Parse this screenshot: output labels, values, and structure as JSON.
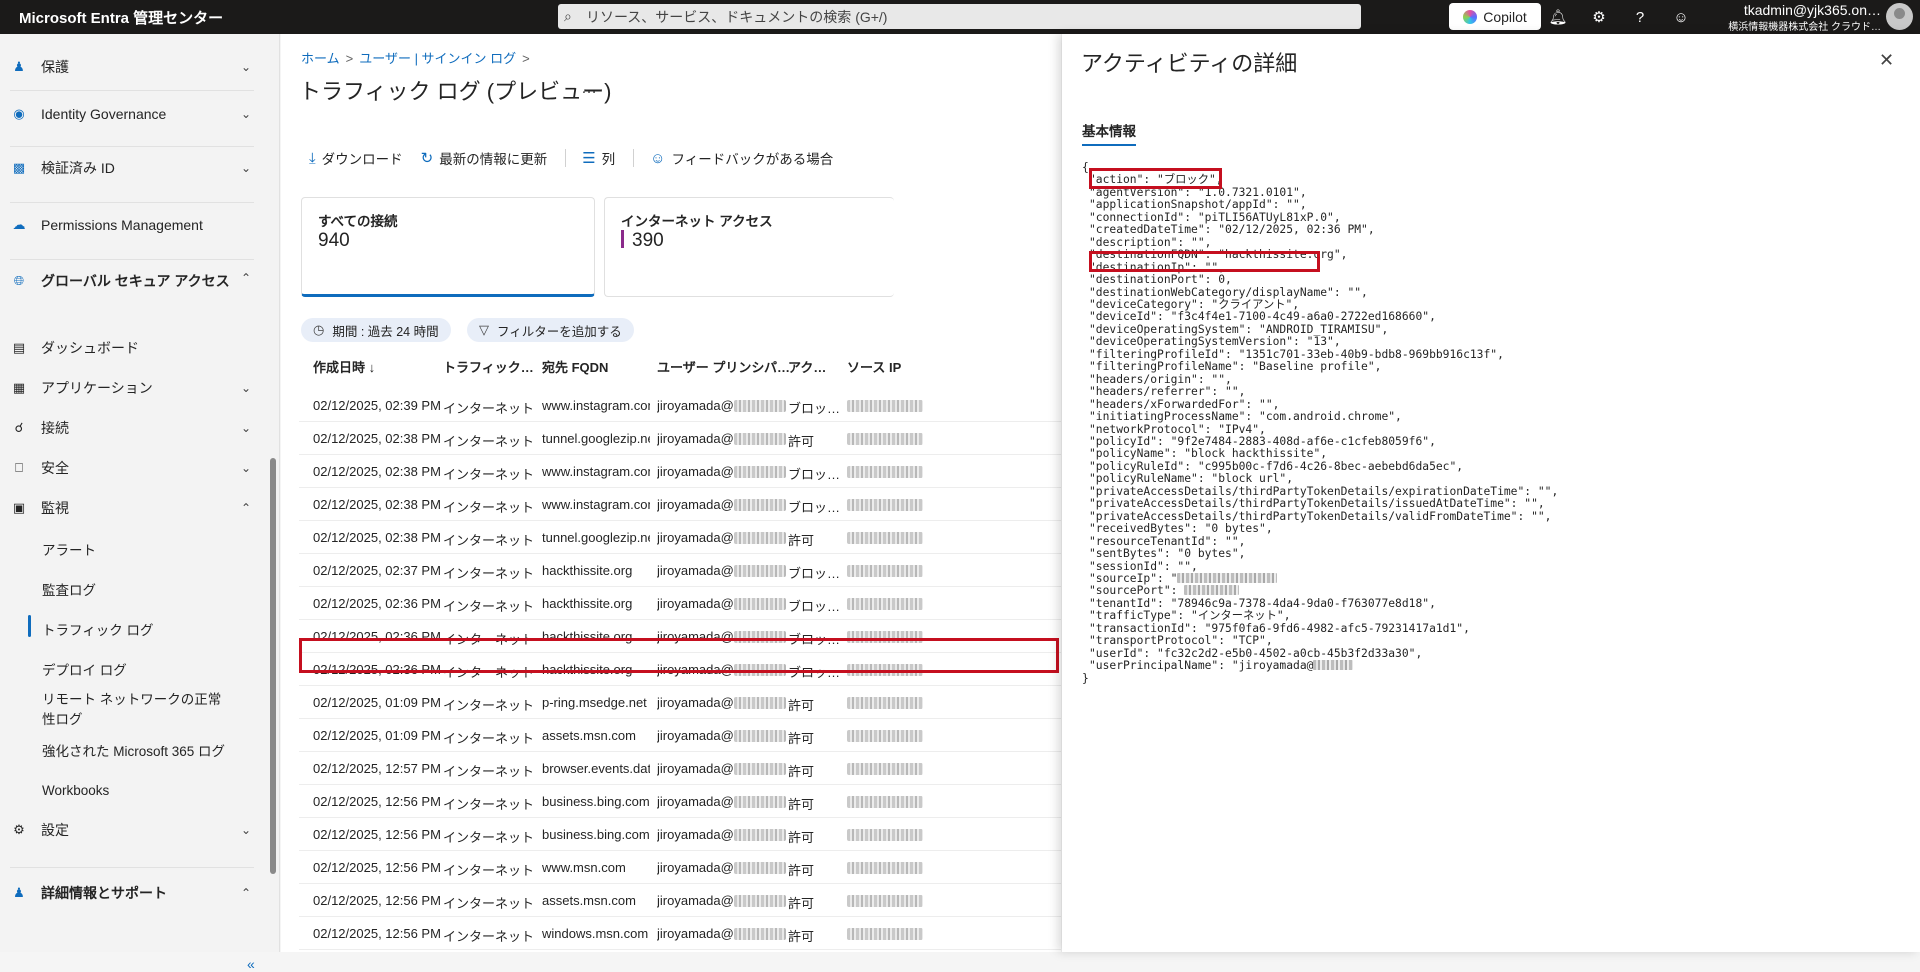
{
  "topbar": {
    "brand": "Microsoft Entra 管理センター",
    "search_placeholder": "リソース、サービス、ドキュメントの検索 (G+/)",
    "copilot": "Copilot",
    "account_email": "tkadmin@yjk365.on…",
    "account_org": "横浜情報機器株式会社 クラウド…"
  },
  "sidebar": {
    "sections": [
      {
        "label": "保護",
        "icon": "person-shield-icon",
        "chevron": "down"
      },
      {
        "label": "Identity Governance",
        "icon": "identity-governance-icon",
        "chevron": "down"
      },
      {
        "label": "検証済み ID",
        "icon": "id-card-icon",
        "chevron": "down"
      },
      {
        "label": "Permissions Management",
        "icon": "cloud-icon",
        "chevron": ""
      },
      {
        "label": "グローバル セキュア アクセス",
        "icon": "globe-icon",
        "chevron": "up"
      }
    ],
    "gsa_items": [
      {
        "label": "ダッシュボード",
        "icon": "dashboard-icon",
        "chevron": ""
      },
      {
        "label": "アプリケーション",
        "icon": "apps-icon",
        "chevron": "down"
      },
      {
        "label": "接続",
        "icon": "connect-icon",
        "chevron": "down"
      },
      {
        "label": "安全",
        "icon": "lock-icon",
        "chevron": "down"
      },
      {
        "label": "監視",
        "icon": "monitor-icon",
        "chevron": "up"
      }
    ],
    "monitor_items": [
      "アラート",
      "監査ログ",
      "トラフィック ログ",
      "デプロイ ログ",
      "リモート ネットワークの正常性ログ",
      "強化された Microsoft 365 ログ",
      "Workbooks"
    ],
    "settings": "設定",
    "help": "詳細情報とサポート",
    "collapse": "«"
  },
  "main": {
    "breadcrumb": [
      "ホーム",
      "ユーザー | サインイン ログ"
    ],
    "title": "トラフィック ログ (プレビュー)",
    "more": "…",
    "toolbar": [
      "ダウンロード",
      "最新の情報に更新",
      "列",
      "フィードバックがある場合"
    ],
    "cards": [
      {
        "title": "すべての接続",
        "value": "940"
      },
      {
        "title": "インターネット アクセス",
        "value": "390"
      }
    ],
    "filters": [
      "期間 : 過去 24 時間",
      "フィルターを追加する"
    ],
    "columns": [
      "作成日時 ↓",
      "トラフィック…",
      "宛先 FQDN",
      "ユーザー プリンシパ…",
      "アク…",
      "ソース IP"
    ],
    "rows": [
      {
        "time": "02/12/2025, 02:39 PM",
        "traffic": "インターネット",
        "fqdn": "www.instagram.com",
        "user": "jiroyamada@",
        "action": "ブロッ…"
      },
      {
        "time": "02/12/2025, 02:38 PM",
        "traffic": "インターネット",
        "fqdn": "tunnel.googlezip.net",
        "user": "jiroyamada@",
        "action": "許可"
      },
      {
        "time": "02/12/2025, 02:38 PM",
        "traffic": "インターネット",
        "fqdn": "www.instagram.com",
        "user": "jiroyamada@",
        "action": "ブロッ…"
      },
      {
        "time": "02/12/2025, 02:38 PM",
        "traffic": "インターネット",
        "fqdn": "www.instagram.com",
        "user": "jiroyamada@",
        "action": "ブロッ…"
      },
      {
        "time": "02/12/2025, 02:38 PM",
        "traffic": "インターネット",
        "fqdn": "tunnel.googlezip.net",
        "user": "jiroyamada@",
        "action": "許可"
      },
      {
        "time": "02/12/2025, 02:37 PM",
        "traffic": "インターネット",
        "fqdn": "hackthissite.org",
        "user": "jiroyamada@",
        "action": "ブロッ…"
      },
      {
        "time": "02/12/2025, 02:36 PM",
        "traffic": "インターネット",
        "fqdn": "hackthissite.org",
        "user": "jiroyamada@",
        "action": "ブロッ…"
      },
      {
        "time": "02/12/2025, 02:36 PM",
        "traffic": "インターネット",
        "fqdn": "hackthissite.org",
        "user": "jiroyamada@",
        "action": "ブロッ…"
      },
      {
        "time": "02/12/2025, 02:36 PM",
        "traffic": "インターネット",
        "fqdn": "hackthissite.org",
        "user": "jiroyamada@",
        "action": "ブロッ…"
      },
      {
        "time": "02/12/2025, 01:09 PM",
        "traffic": "インターネット",
        "fqdn": "p-ring.msedge.net",
        "user": "jiroyamada@",
        "action": "許可"
      },
      {
        "time": "02/12/2025, 01:09 PM",
        "traffic": "インターネット",
        "fqdn": "assets.msn.com",
        "user": "jiroyamada@",
        "action": "許可"
      },
      {
        "time": "02/12/2025, 12:57 PM",
        "traffic": "インターネット",
        "fqdn": "browser.events.dat…",
        "user": "jiroyamada@",
        "action": "許可"
      },
      {
        "time": "02/12/2025, 12:56 PM",
        "traffic": "インターネット",
        "fqdn": "business.bing.com",
        "user": "jiroyamada@",
        "action": "許可"
      },
      {
        "time": "02/12/2025, 12:56 PM",
        "traffic": "インターネット",
        "fqdn": "business.bing.com",
        "user": "jiroyamada@",
        "action": "許可"
      },
      {
        "time": "02/12/2025, 12:56 PM",
        "traffic": "インターネット",
        "fqdn": "www.msn.com",
        "user": "jiroyamada@",
        "action": "許可"
      },
      {
        "time": "02/12/2025, 12:56 PM",
        "traffic": "インターネット",
        "fqdn": "assets.msn.com",
        "user": "jiroyamada@",
        "action": "許可"
      },
      {
        "time": "02/12/2025, 12:56 PM",
        "traffic": "インターネット",
        "fqdn": "windows.msn.com",
        "user": "jiroyamada@",
        "action": "許可"
      }
    ]
  },
  "panel": {
    "title": "アクティビティの詳細",
    "close": "✕",
    "tab": "基本情報",
    "json_open": "{",
    "json_close": "}",
    "json_lines": [
      "\"action\": \"ブロック\",",
      "\"agentVersion\": \"1.0.7321.0101\",",
      "\"applicationSnapshot/appId\": \"\",",
      "\"connectionId\": \"piTLI56ATUyL81xP.0\",",
      "\"createdDateTime\": \"02/12/2025, 02:36 PM\",",
      "\"description\": \"\",",
      "\"destinationFQDN\": \"hackthissite.org\",",
      "\"destinationIp\": \"\",",
      "\"destinationPort\": 0,",
      "\"destinationWebCategory/displayName\": \"\",",
      "\"deviceCategory\": \"クライアント\",",
      "\"deviceId\": \"f3c4f4e1-7100-4c49-a6a0-2722ed168660\",",
      "\"deviceOperatingSystem\": \"ANDROID_TIRAMISU\",",
      "\"deviceOperatingSystemVersion\": \"13\",",
      "\"filteringProfileId\": \"1351c701-33eb-40b9-bdb8-969bb916c13f\",",
      "\"filteringProfileName\": \"Baseline profile\",",
      "\"headers/origin\": \"\",",
      "\"headers/referrer\": \"\",",
      "\"headers/xForwardedFor\": \"\",",
      "\"initiatingProcessName\": \"com.android.chrome\",",
      "\"networkProtocol\": \"IPv4\",",
      "\"policyId\": \"9f2e7484-2883-408d-af6e-c1cfeb8059f6\",",
      "\"policyName\": \"block hackthissite\",",
      "\"policyRuleId\": \"c995b00c-f7d6-4c26-8bec-aebebd6da5ec\",",
      "\"policyRuleName\": \"block url\",",
      "\"privateAccessDetails/thirdPartyTokenDetails/expirationDateTime\": \"\",",
      "\"privateAccessDetails/thirdPartyTokenDetails/issuedAtDateTime\": \"\",",
      "\"privateAccessDetails/thirdPartyTokenDetails/validFromDateTime\": \"\",",
      "\"receivedBytes\": \"0 bytes\",",
      "\"resourceTenantId\": \"\",",
      "\"sentBytes\": \"0 bytes\",",
      "\"sessionId\": \"\",",
      "\"sourceIp\": \"",
      "\"sourcePort\": ",
      "\"tenantId\": \"78946c9a-7378-4da4-9da0-f763077e8d18\",",
      "\"trafficType\": \"インターネット\",",
      "\"transactionId\": \"975f0fa6-9fd6-4982-afc5-79231417a1d1\",",
      "\"transportProtocol\": \"TCP\",",
      "\"userId\": \"fc32c2d2-e5b0-4502-a0cb-45b3f2d33a30\",",
      "\"userPrincipalName\": \"jiroyamada@"
    ]
  },
  "colors": {
    "accent": "#0f6cbd",
    "highlight": "#c50f1f",
    "topbar": "#1b1a19"
  }
}
